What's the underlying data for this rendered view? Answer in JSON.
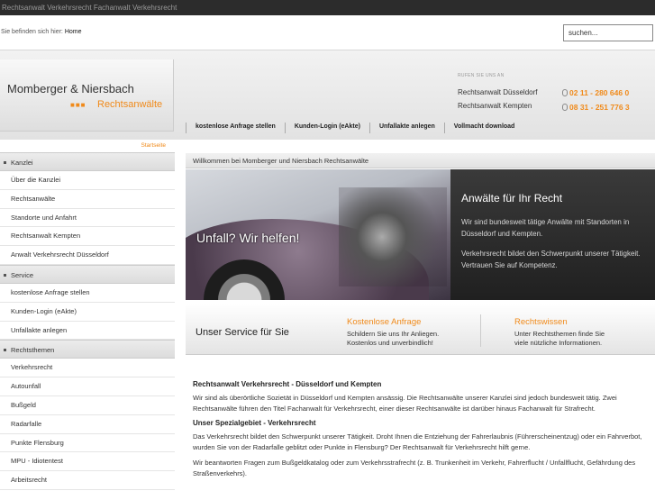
{
  "topbar": {
    "text": "Rechtsanwalt Verkehrsrecht Fachanwalt Verkehrsrecht"
  },
  "breadcrumb": {
    "prefix": "Sie befinden sich hier:",
    "current": "Home"
  },
  "search": {
    "placeholder": "suchen..."
  },
  "logo": {
    "name": "Momberger & Niersbach",
    "dots": "■■■",
    "sub": "Rechtsanwälte"
  },
  "contact": {
    "heading": "RUFEN SIE UNS AN",
    "offices": [
      {
        "label": "Rechtsanwalt Düsseldorf",
        "phone": "02 11 - 280 646 0"
      },
      {
        "label": "Rechtsanwalt Kempten",
        "phone": "08 31 - 251 776 3"
      }
    ]
  },
  "nav": [
    "kostenlose Anfrage stellen",
    "Kunden-Login (eAkte)",
    "Unfallakte anlegen",
    "Vollmacht download"
  ],
  "sidebar": {
    "startseite": "Startseite",
    "sections": [
      {
        "title": "Kanzlei",
        "items": [
          "Über die Kanzlei",
          "Rechtsanwälte",
          "Standorte und Anfahrt",
          "Rechtsanwalt Kempten",
          "Anwalt Verkehrsrecht Düsseldorf"
        ]
      },
      {
        "title": "Service",
        "items": [
          "kostenlose Anfrage stellen",
          "Kunden-Login (eAkte)",
          "Unfallakte anlegen"
        ]
      },
      {
        "title": "Rechtsthemen",
        "items": [
          "Verkehrsrecht",
          "Autounfall",
          "Bußgeld",
          "Radarfalle",
          "Punkte Flensburg",
          "MPU - Idiotentest",
          "Arbeitsrecht"
        ]
      }
    ]
  },
  "welcome": "Willkommen bei Momberger und Niersbach Rechtsanwälte",
  "banner": {
    "slogan": "Unfall? Wir helfen!",
    "title": "Anwälte für Ihr Recht",
    "p1": "Wir sind bundesweit tätige Anwälte mit Standorten in Düsseldorf und Kempten.",
    "p2": "Verkehrsrecht bildet den Schwerpunkt unserer Tätigkeit. Vertrauen Sie auf Kompetenz."
  },
  "service": {
    "title": "Unser Service für Sie",
    "col1": {
      "heading": "Kostenlose Anfrage",
      "line1": "Schildern Sie uns Ihr Anliegen.",
      "line2": "Kostenlos und unverbindlich!"
    },
    "col2": {
      "heading": "Rechtswissen",
      "line1": "Unter Rechtsthemen finde Sie",
      "line2": "viele nützliche Informationen."
    }
  },
  "article": {
    "h1": "Rechtsanwalt Verkehrsrecht - Düsseldorf und Kempten",
    "p1": "Wir sind als überörtliche Sozietät in Düsseldorf und Kempten ansässig. Die Rechtsanwälte unserer Kanzlei sind jedoch bundesweit tätig. Zwei Rechtsanwälte führen den Titel Fachanwalt für Verkehrsrecht, einer dieser Rechtsanwälte ist darüber hinaus Fachanwalt für Strafrecht.",
    "h2": "Unser Spezialgebiet - Verkehrsrecht",
    "p2": "Das Verkehrsrecht bildet den Schwerpunkt unserer Tätigkeit. Droht Ihnen die Entziehung der Fahrerlaubnis (Führerscheinentzug) oder ein Fahrverbot, wurden Sie von der Radarfalle geblitzt oder Punkte in Flensburg? Der Rechtsanwalt für Verkehrsrecht hilft gerne.",
    "p3": "Wir beantworten Fragen zum Bußgeldkatalog oder zum Verkehrsstrafrecht (z. B. Trunkenheit im Verkehr, Fahrerflucht / Unfallflucht, Gefährdung des Straßenverkehrs)."
  }
}
